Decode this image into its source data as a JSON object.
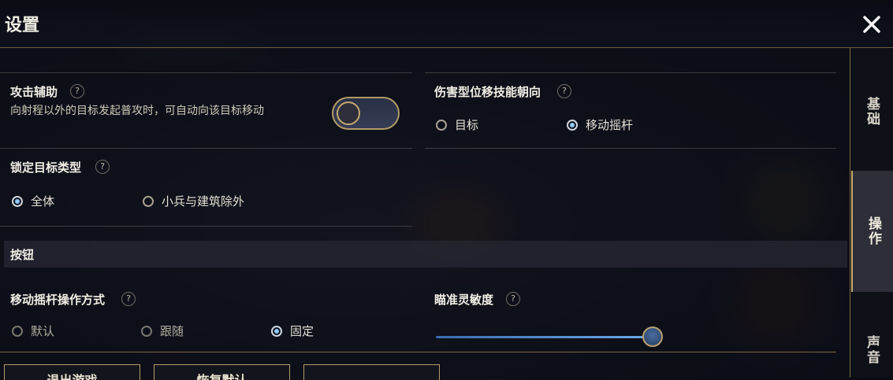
{
  "header": {
    "title": "设置"
  },
  "attack_assist": {
    "label": "攻击辅助",
    "help": "?",
    "description": "向射程以外的目标发起普攻时，可自动向该目标移动",
    "toggle_on": false
  },
  "damage_skill_direction": {
    "label": "伤害型位移技能朝向",
    "help": "?",
    "options": [
      "目标",
      "移动摇杆"
    ],
    "selected": "移动摇杆"
  },
  "lock_target_type": {
    "label": "锁定目标类型",
    "help": "?",
    "options": [
      "全体",
      "小兵与建筑除外"
    ],
    "selected": "全体"
  },
  "section_buttons": {
    "title": "按钮"
  },
  "joystick_mode": {
    "label": "移动摇杆操作方式",
    "help": "?",
    "options": [
      "默认",
      "跟随",
      "固定"
    ],
    "selected": "固定"
  },
  "aim_sensitivity": {
    "label": "瞄准灵敏度",
    "help": "?",
    "value_fraction": 1.0
  },
  "side_tabs": [
    {
      "label": "基础",
      "active": false
    },
    {
      "label": "操作",
      "active": true
    },
    {
      "label": "声音",
      "active": false
    }
  ],
  "bottom_buttons": [
    "退出游戏",
    "恢复默认"
  ],
  "colors": {
    "accent_gold": "#b49b68",
    "radio_selected": "#8fc9ff",
    "slider_blue": "#4a86d4"
  },
  "icons": {
    "close": "close-icon",
    "help": "question-icon"
  }
}
